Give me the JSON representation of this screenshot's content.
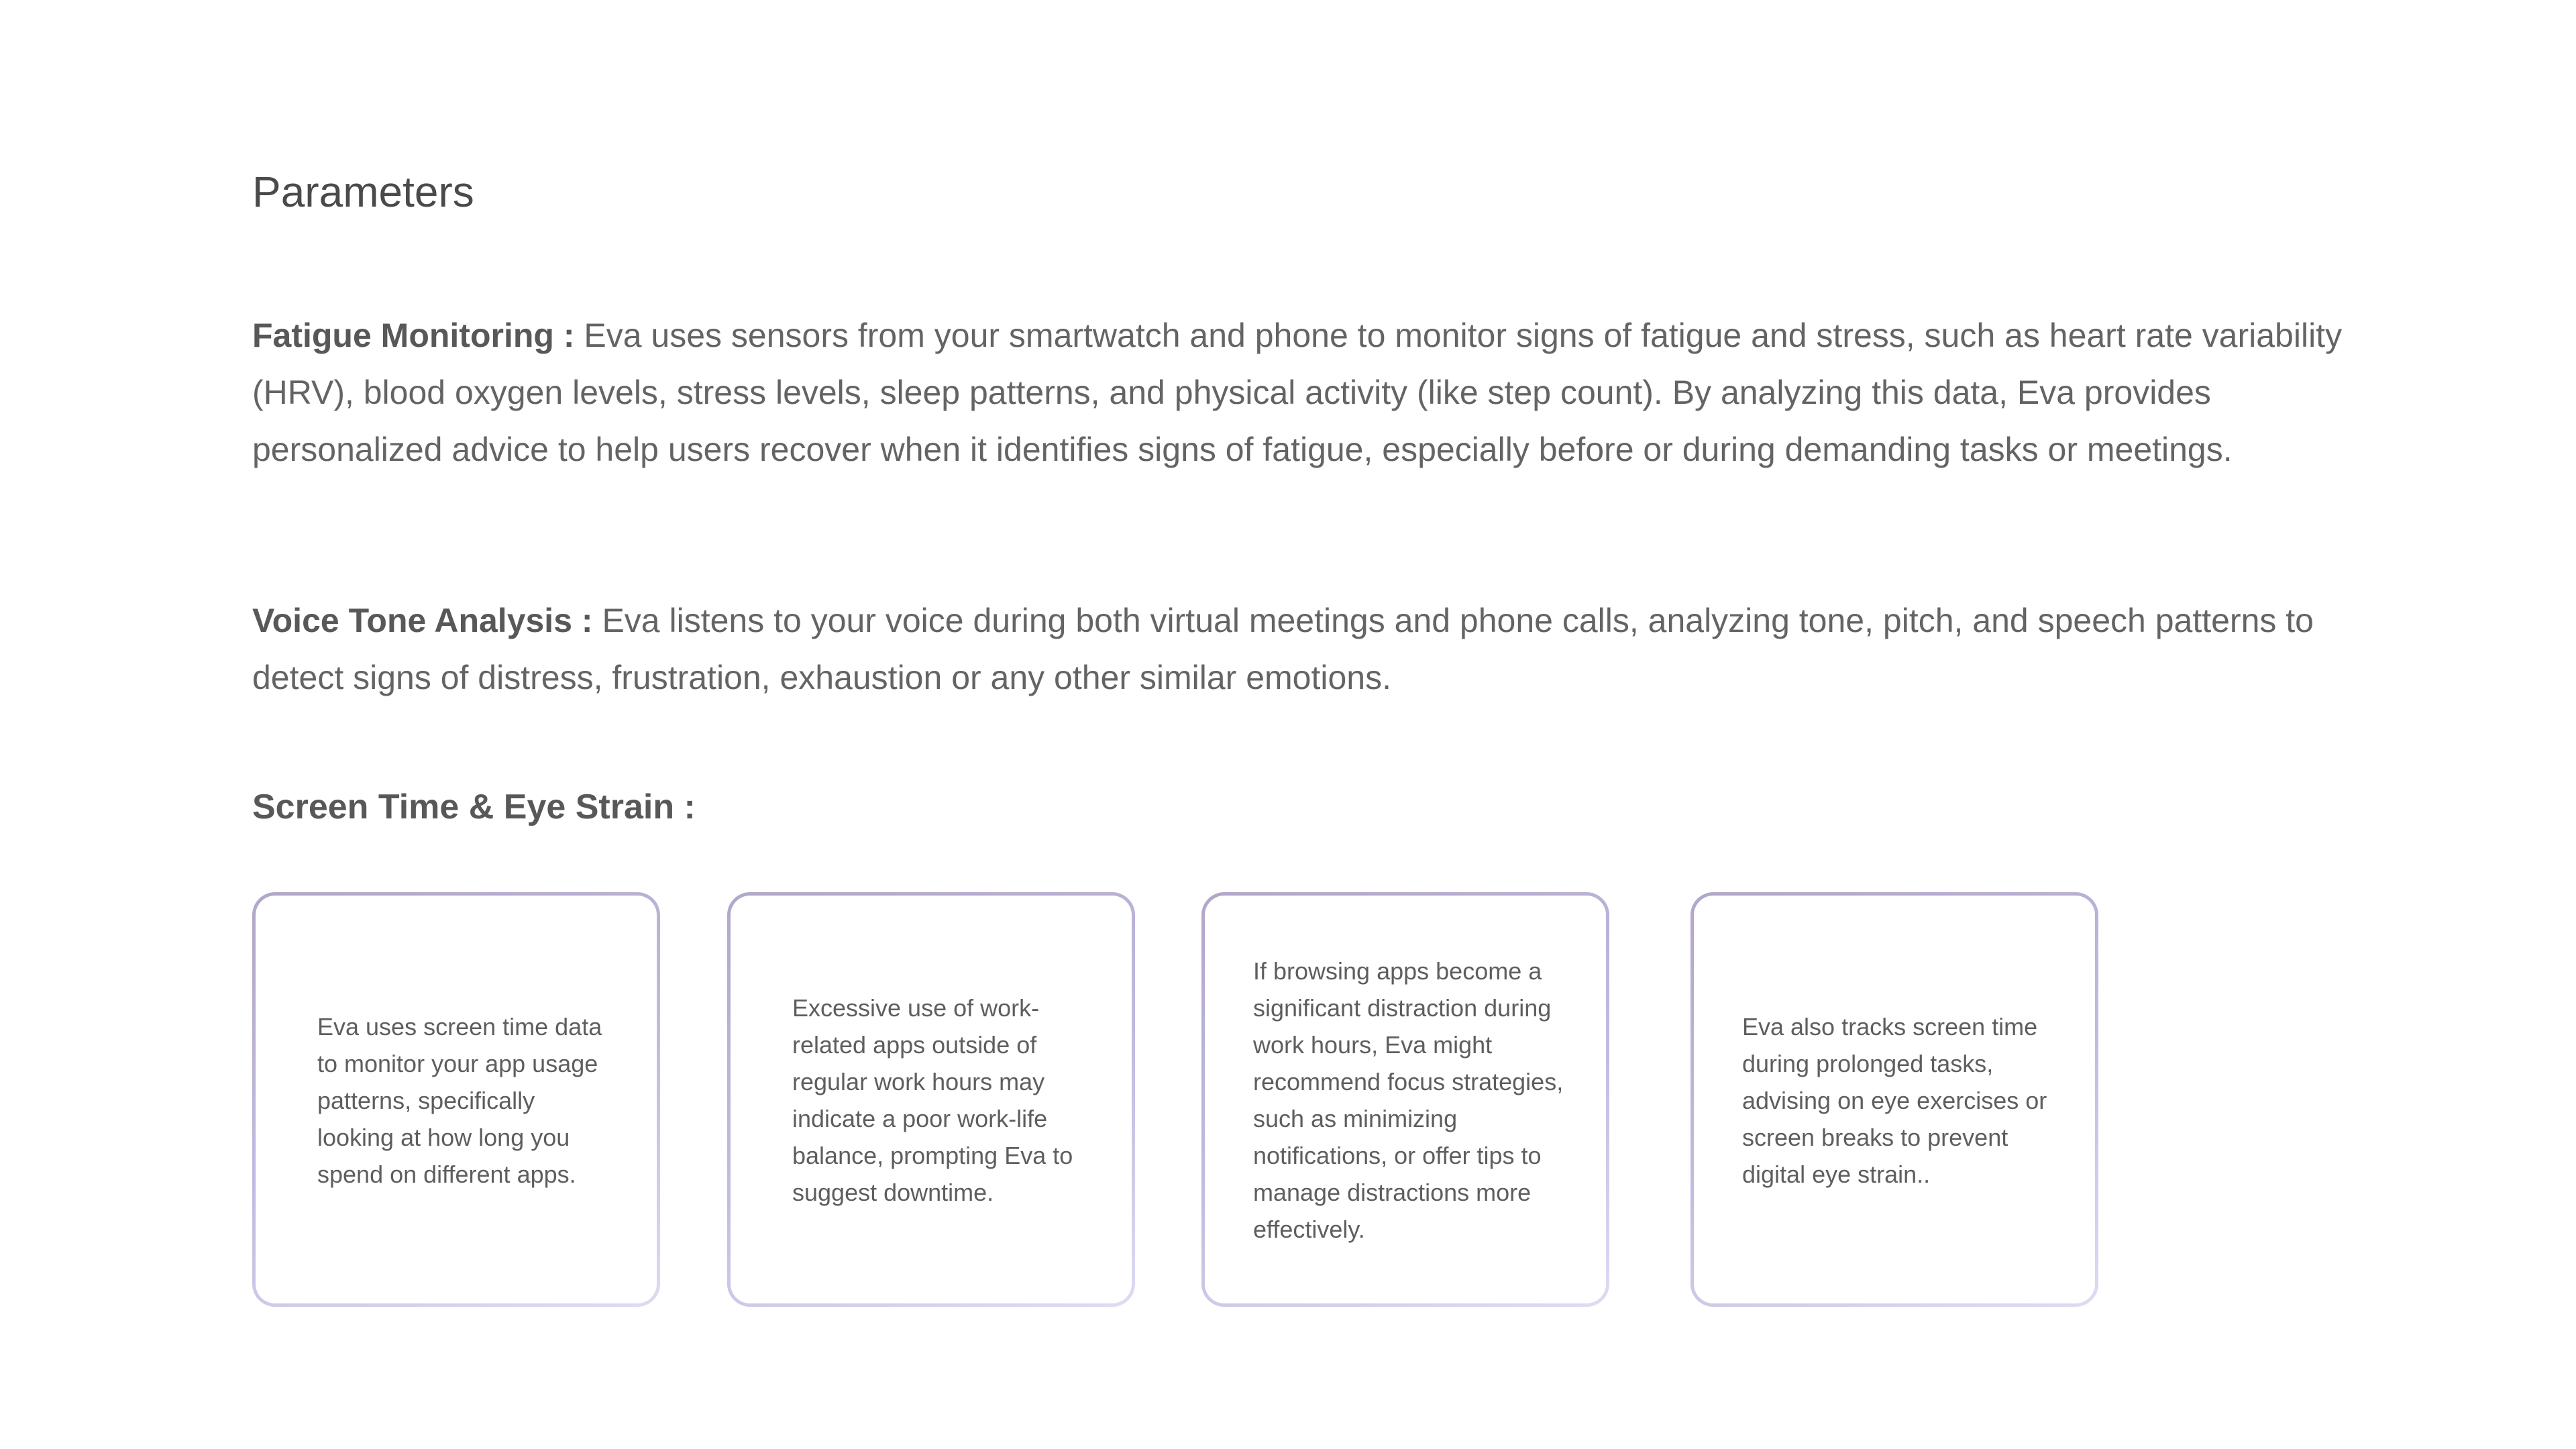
{
  "page": {
    "title": "Parameters"
  },
  "sections": [
    {
      "label": "Fatigue Monitoring :",
      "text": " Eva uses sensors from your smartwatch and phone to monitor signs of fatigue and stress, such as heart rate variability (HRV), blood oxygen levels, stress levels, sleep patterns, and physical activity (like step count). By analyzing this data, Eva provides personalized advice to help users recover when it identifies signs of fatigue, especially before or during demanding tasks or meetings."
    },
    {
      "label": "Voice Tone Analysis :",
      "text": " Eva listens to your voice during both virtual meetings and phone calls, analyzing tone, pitch, and speech patterns to detect signs of distress, frustration, exhaustion or any other similar emotions."
    }
  ],
  "screen_time": {
    "heading": "Screen Time & Eye Strain :",
    "cards": [
      {
        "text": "Eva uses screen time data to monitor your app usage patterns, specifically looking at how long you spend on different apps."
      },
      {
        "text": "Excessive use of work-related apps outside of regular work hours may indicate a poor work-life balance, prompting Eva to suggest downtime."
      },
      {
        "text": "If browsing apps become a significant distraction during work hours, Eva might recommend focus strategies, such as minimizing notifications, or offer tips to manage distractions more effectively."
      },
      {
        "text": "Eva also tracks screen time during prolonged tasks, advising on eye exercises or screen breaks to prevent digital eye strain.."
      }
    ]
  },
  "colors": {
    "title": "#4a4a4a",
    "body_text": "#646464",
    "card_border_start": "#b2a6c9",
    "card_border_end": "#dcdcf3"
  }
}
